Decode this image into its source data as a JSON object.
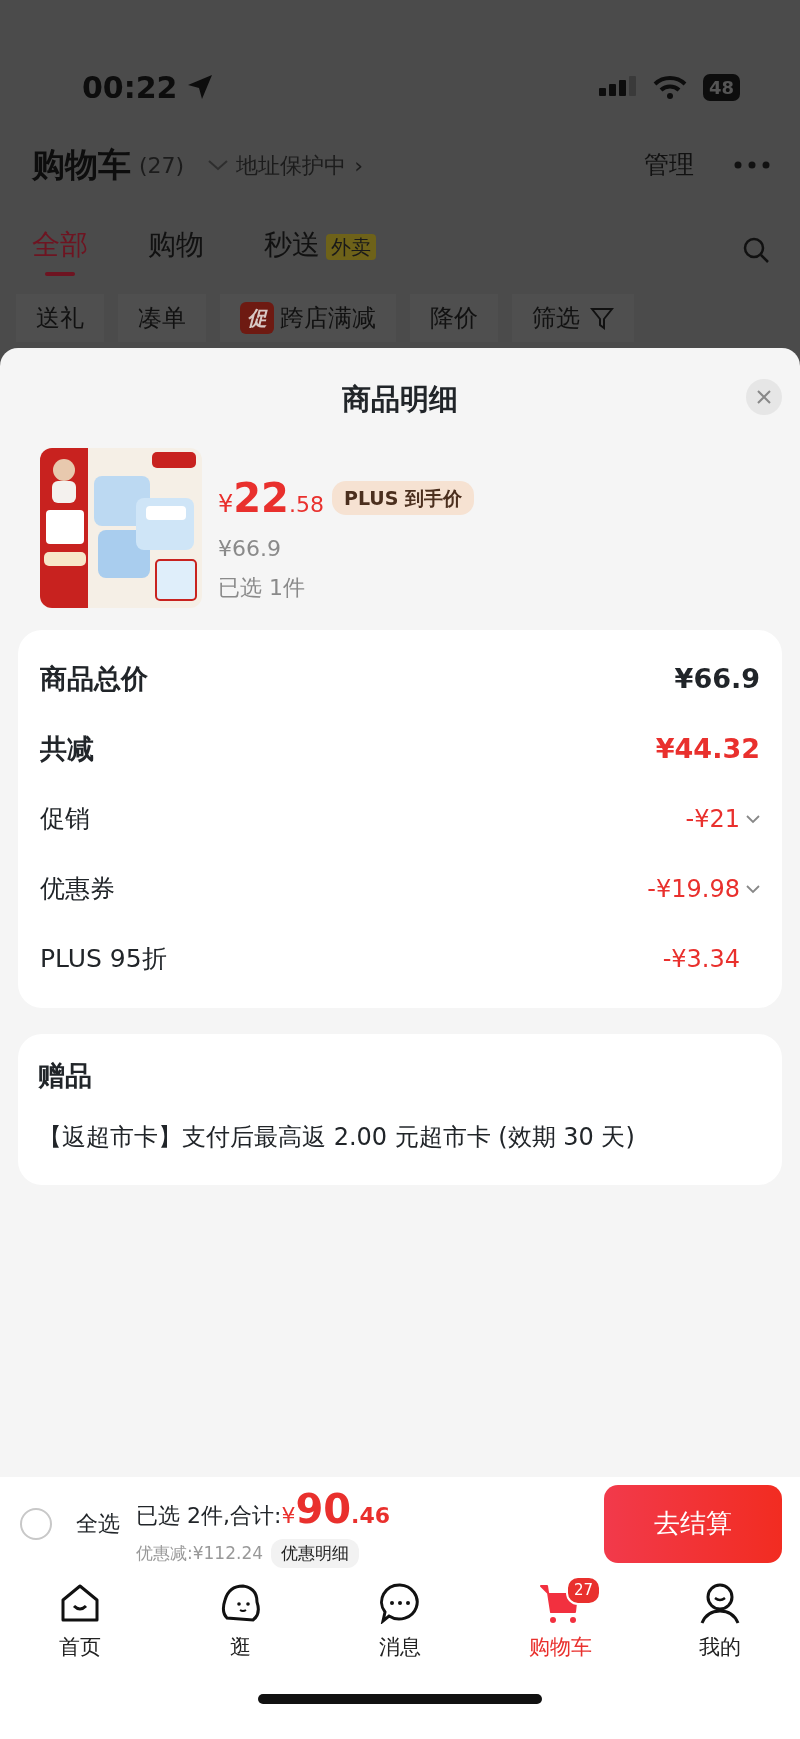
{
  "status_bar": {
    "time": "00:22",
    "battery": "48"
  },
  "header": {
    "title": "购物车",
    "count": "(27)",
    "address": "地址保护中",
    "chevron": "›",
    "manage": "管理"
  },
  "tabs": [
    {
      "label": "全部",
      "selected": true
    },
    {
      "label": "购物",
      "selected": false
    },
    {
      "label": "秒送",
      "badge": "外卖",
      "selected": false
    }
  ],
  "filters": [
    {
      "label": "送礼"
    },
    {
      "label": "凑单"
    },
    {
      "label": "跨店满减",
      "tag": "促"
    },
    {
      "label": "降价"
    },
    {
      "label": "筛选",
      "kind": "filter"
    }
  ],
  "sheet": {
    "title": "商品明细",
    "product": {
      "price_symbol": "¥",
      "price_int": "22",
      "price_dec": ".58",
      "price_tag": "PLUS 到手价",
      "original_price": "¥66.9",
      "selected_count": "已选 1件"
    },
    "summary": [
      {
        "label": "商品总价",
        "value": "¥66.9",
        "kind": "total"
      },
      {
        "label": "共减",
        "value": "¥44.32",
        "kind": "discount_total"
      },
      {
        "label": "促销",
        "value": "-¥21",
        "kind": "item",
        "expandable": true
      },
      {
        "label": "优惠券",
        "value": "-¥19.98",
        "kind": "item",
        "expandable": true
      },
      {
        "label": "PLUS 95折",
        "value": "-¥3.34",
        "kind": "item",
        "expandable": false
      }
    ],
    "gift": {
      "title": "赠品",
      "text": "【返超市卡】支付后最高返 2.00 元超市卡 (效期 30 天)"
    }
  },
  "checkout": {
    "select_all": {
      "label": "全选",
      "checked": false
    },
    "summary_label": "已选 2件,合计:",
    "total_symbol": "¥",
    "total_int": "90",
    "total_dec": ".46",
    "saving": "优惠减:¥112.24",
    "detail_button": "优惠明细",
    "submit": "去结算"
  },
  "bottom_nav": [
    {
      "label": "首页",
      "selected": false
    },
    {
      "label": "逛",
      "selected": false
    },
    {
      "label": "消息",
      "selected": false
    },
    {
      "label": "购物车",
      "badge": "27",
      "selected": true
    },
    {
      "label": "我的",
      "selected": false
    }
  ]
}
